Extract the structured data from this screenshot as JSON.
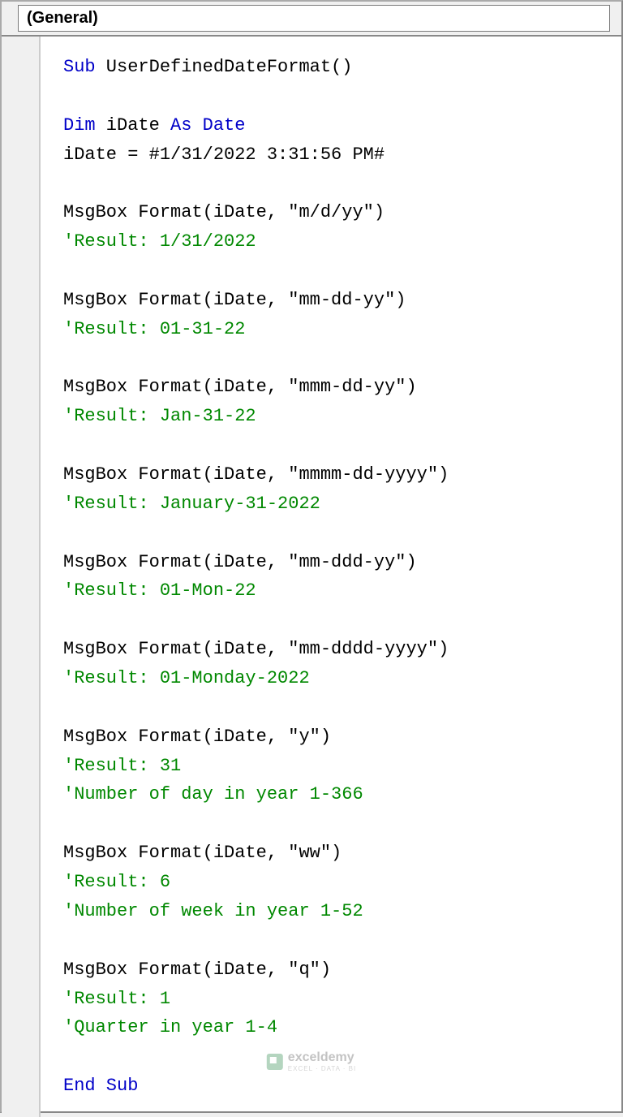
{
  "dropdown": {
    "object": "(General)"
  },
  "code": {
    "lines": [
      [
        {
          "t": "kw",
          "v": "Sub"
        },
        {
          "t": "ident",
          "v": " UserDefinedDateFormat()"
        }
      ],
      [
        {
          "t": "ident",
          "v": ""
        }
      ],
      [
        {
          "t": "kw",
          "v": "Dim"
        },
        {
          "t": "ident",
          "v": " iDate "
        },
        {
          "t": "kw",
          "v": "As Date"
        }
      ],
      [
        {
          "t": "ident",
          "v": "iDate = #1/31/2022 3:31:56 PM#"
        }
      ],
      [
        {
          "t": "ident",
          "v": ""
        }
      ],
      [
        {
          "t": "ident",
          "v": "MsgBox Format(iDate, \"m/d/yy\")"
        }
      ],
      [
        {
          "t": "cm",
          "v": "'Result: 1/31/2022"
        }
      ],
      [
        {
          "t": "ident",
          "v": ""
        }
      ],
      [
        {
          "t": "ident",
          "v": "MsgBox Format(iDate, \"mm-dd-yy\")"
        }
      ],
      [
        {
          "t": "cm",
          "v": "'Result: 01-31-22"
        }
      ],
      [
        {
          "t": "ident",
          "v": ""
        }
      ],
      [
        {
          "t": "ident",
          "v": "MsgBox Format(iDate, \"mmm-dd-yy\")"
        }
      ],
      [
        {
          "t": "cm",
          "v": "'Result: Jan-31-22"
        }
      ],
      [
        {
          "t": "ident",
          "v": ""
        }
      ],
      [
        {
          "t": "ident",
          "v": "MsgBox Format(iDate, \"mmmm-dd-yyyy\")"
        }
      ],
      [
        {
          "t": "cm",
          "v": "'Result: January-31-2022"
        }
      ],
      [
        {
          "t": "ident",
          "v": ""
        }
      ],
      [
        {
          "t": "ident",
          "v": "MsgBox Format(iDate, \"mm-ddd-yy\")"
        }
      ],
      [
        {
          "t": "cm",
          "v": "'Result: 01-Mon-22"
        }
      ],
      [
        {
          "t": "ident",
          "v": ""
        }
      ],
      [
        {
          "t": "ident",
          "v": "MsgBox Format(iDate, \"mm-dddd-yyyy\")"
        }
      ],
      [
        {
          "t": "cm",
          "v": "'Result: 01-Monday-2022"
        }
      ],
      [
        {
          "t": "ident",
          "v": ""
        }
      ],
      [
        {
          "t": "ident",
          "v": "MsgBox Format(iDate, \"y\")"
        }
      ],
      [
        {
          "t": "cm",
          "v": "'Result: 31"
        }
      ],
      [
        {
          "t": "cm",
          "v": "'Number of day in year 1-366"
        }
      ],
      [
        {
          "t": "ident",
          "v": ""
        }
      ],
      [
        {
          "t": "ident",
          "v": "MsgBox Format(iDate, \"ww\")"
        }
      ],
      [
        {
          "t": "cm",
          "v": "'Result: 6"
        }
      ],
      [
        {
          "t": "cm",
          "v": "'Number of week in year 1-52"
        }
      ],
      [
        {
          "t": "ident",
          "v": ""
        }
      ],
      [
        {
          "t": "ident",
          "v": "MsgBox Format(iDate, \"q\")"
        }
      ],
      [
        {
          "t": "cm",
          "v": "'Result: 1"
        }
      ],
      [
        {
          "t": "cm",
          "v": "'Quarter in year 1-4"
        }
      ],
      [
        {
          "t": "ident",
          "v": ""
        }
      ],
      [
        {
          "t": "kw",
          "v": "End Sub"
        }
      ]
    ]
  },
  "watermark": {
    "brand": "exceldemy",
    "tagline": "EXCEL · DATA · BI"
  }
}
